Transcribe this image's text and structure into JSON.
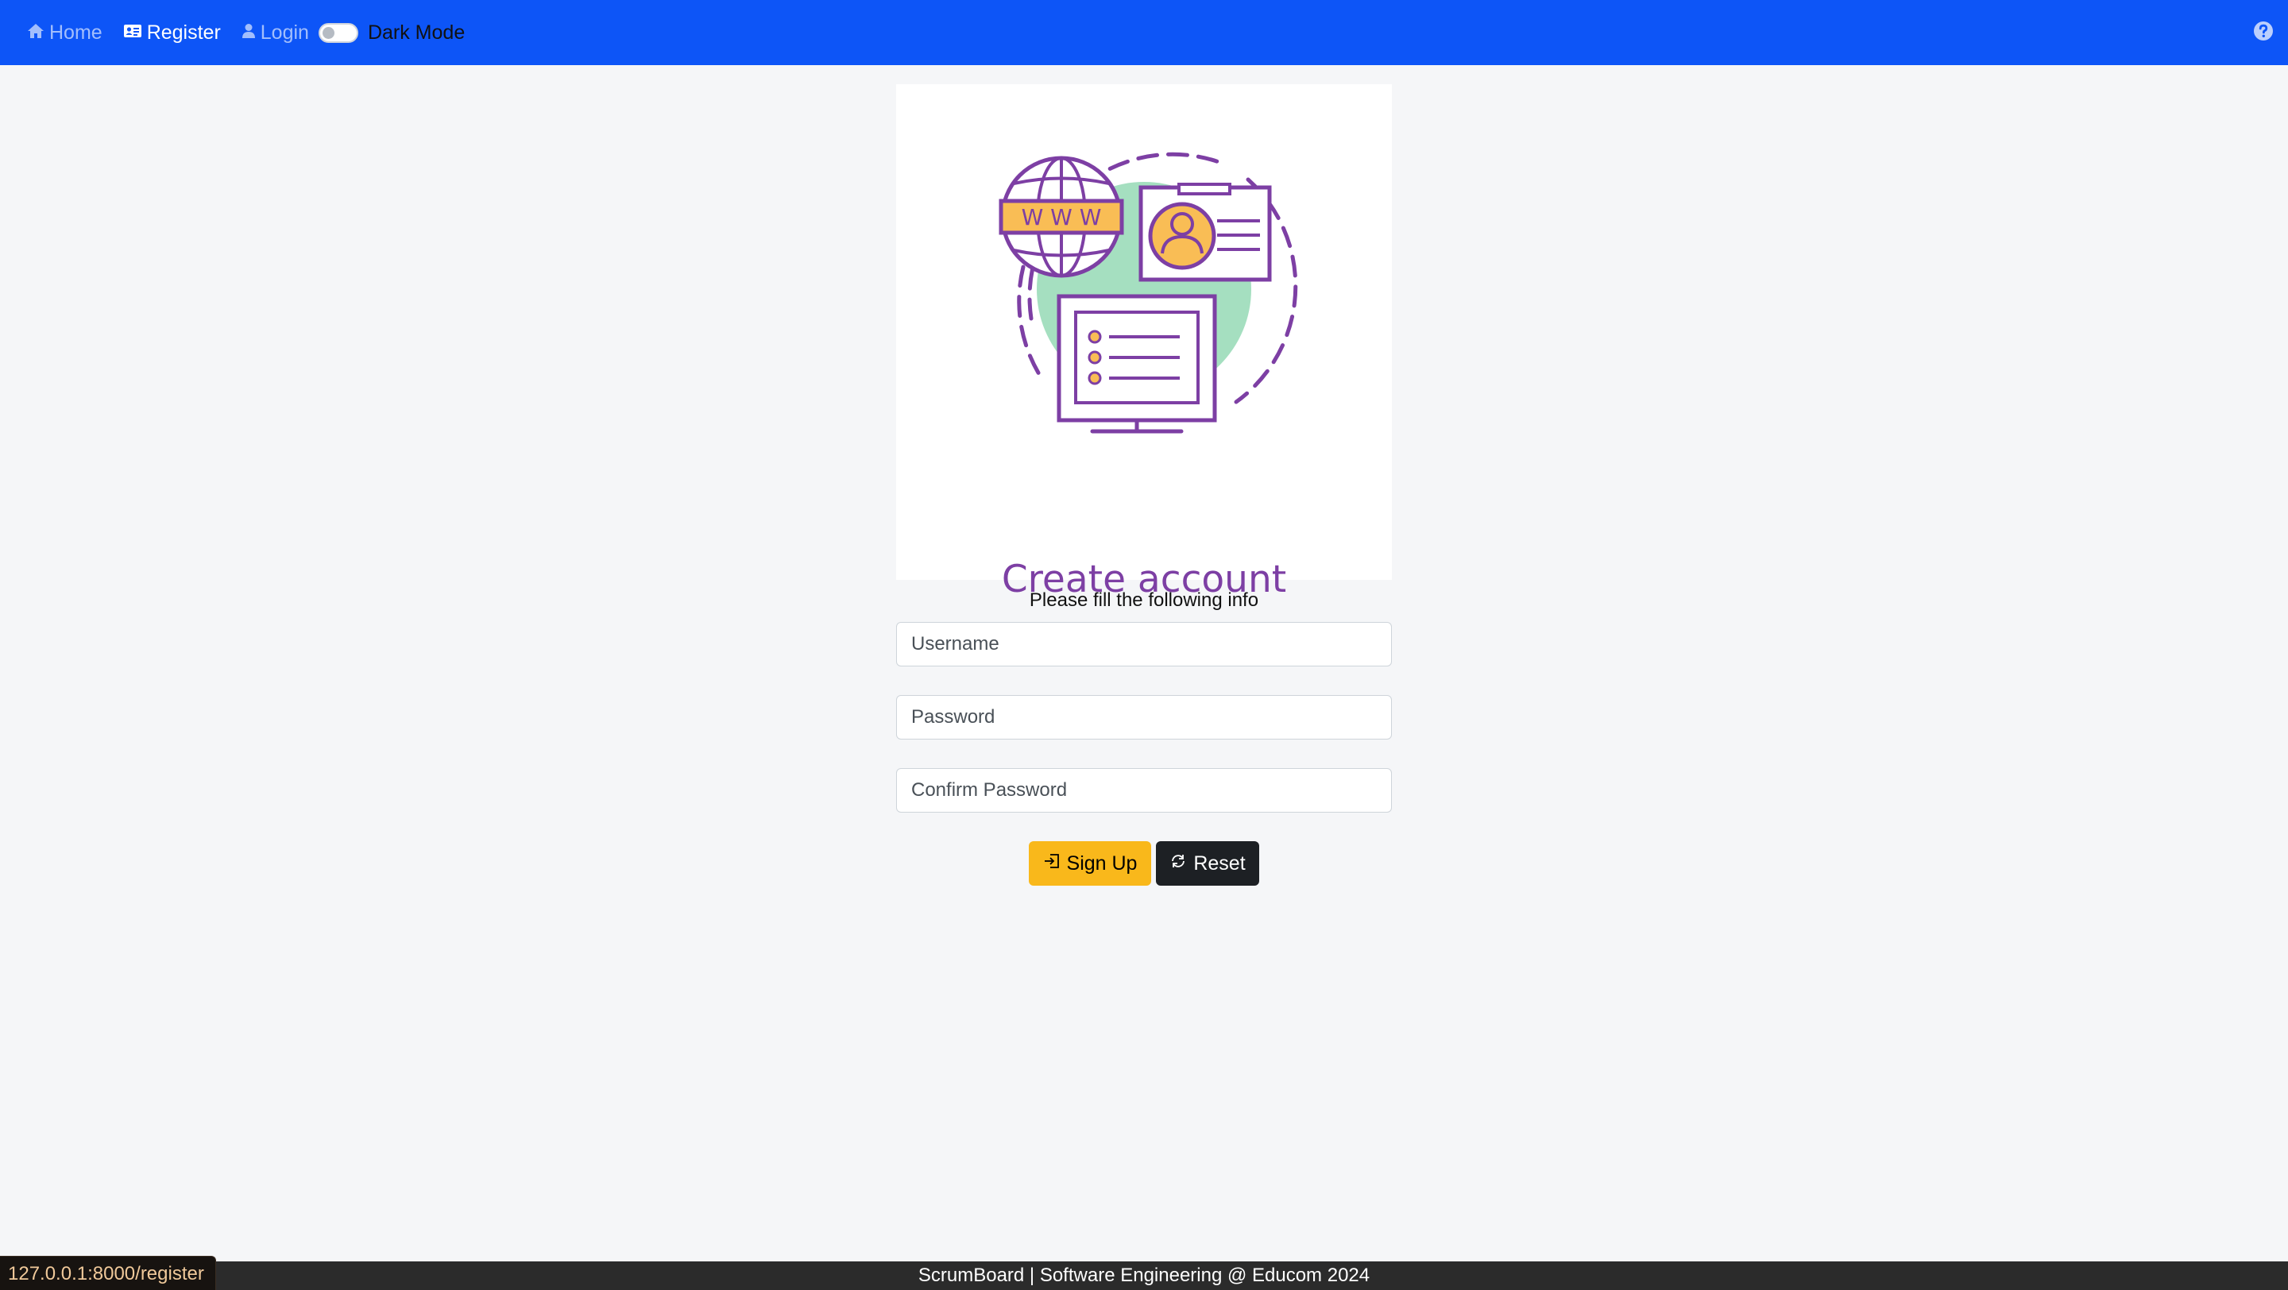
{
  "nav": {
    "home_label": "Home",
    "register_label": "Register",
    "login_label": "Login",
    "dark_mode_label": "Dark Mode",
    "dark_mode_on": false,
    "icons": [
      "home-icon",
      "id-card-icon",
      "user-icon",
      "question-circle-icon"
    ]
  },
  "card": {
    "caption": "Create account",
    "illustration_badge": "W W W",
    "colors": {
      "line": "#7d3fa4",
      "accent": "#f9bd55",
      "blob": "#a5dfc0"
    }
  },
  "form": {
    "instruction": "Please fill the following info",
    "username_placeholder": "Username",
    "password_placeholder": "Password",
    "confirm_password_placeholder": "Confirm Password",
    "signup_label": "Sign Up",
    "reset_label": "Reset"
  },
  "footer": {
    "text": "ScrumBoard | Software Engineering @ Educom 2024"
  },
  "status_bar": {
    "url": "127.0.0.1:8000/register"
  },
  "colors": {
    "navbar": "#0d55f7",
    "primary_button": "#f9b81b",
    "dark_button": "#1d2024",
    "page_background": "#f5f6f8"
  }
}
